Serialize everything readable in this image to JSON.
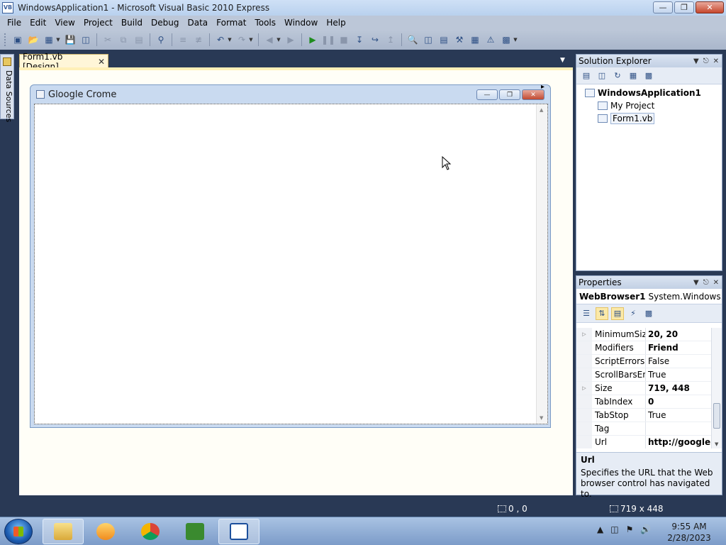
{
  "window": {
    "title": "WindowsApplication1 - Microsoft Visual Basic 2010 Express",
    "app_icon": "VB"
  },
  "menu": [
    "File",
    "Edit",
    "View",
    "Project",
    "Build",
    "Debug",
    "Data",
    "Format",
    "Tools",
    "Window",
    "Help"
  ],
  "side_tab": {
    "label": "Data Sources"
  },
  "document_tab": {
    "label": "Form1.vb [Design]"
  },
  "designer": {
    "form_title": "Gloogle Crome"
  },
  "status": {
    "position": "0 , 0",
    "size": "719 x 448"
  },
  "solution_explorer": {
    "title": "Solution Explorer",
    "root": "WindowsApplication1",
    "items": [
      "My Project",
      "Form1.vb"
    ]
  },
  "properties": {
    "title": "Properties",
    "object_name": "WebBrowser1",
    "object_type": "System.Windows.F",
    "rows": [
      {
        "name": "MinimumSize",
        "value": "20, 20",
        "bold": true,
        "expandable": true
      },
      {
        "name": "Modifiers",
        "value": "Friend",
        "bold": true,
        "expandable": false
      },
      {
        "name": "ScriptErrorsSu",
        "value": "False",
        "bold": false,
        "expandable": false
      },
      {
        "name": "ScrollBarsEna",
        "value": "True",
        "bold": false,
        "expandable": false
      },
      {
        "name": "Size",
        "value": "719, 448",
        "bold": true,
        "expandable": true
      },
      {
        "name": "TabIndex",
        "value": "0",
        "bold": true,
        "expandable": false
      },
      {
        "name": "TabStop",
        "value": "True",
        "bold": false,
        "expandable": false
      },
      {
        "name": "Tag",
        "value": "",
        "bold": false,
        "expandable": false
      },
      {
        "name": "Url",
        "value": "http://google.c",
        "bold": true,
        "expandable": false
      }
    ],
    "description_name": "Url",
    "description_text": "Specifies the URL that the Web browser control has navigated to."
  },
  "taskbar": {
    "time": "9:55 AM",
    "date": "2/28/2023"
  }
}
